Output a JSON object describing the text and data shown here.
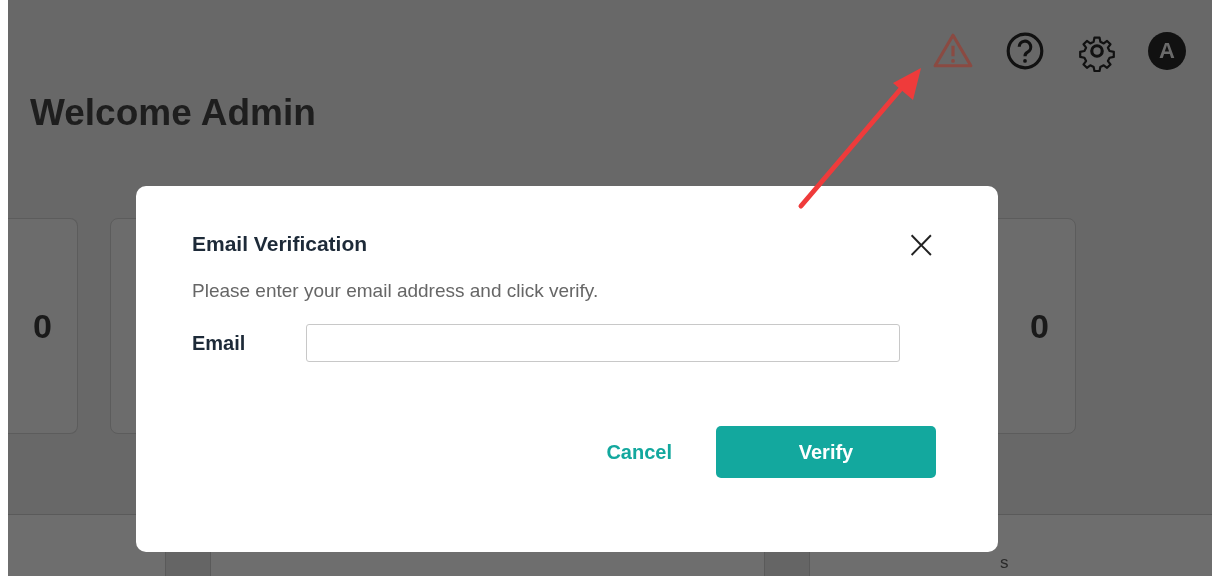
{
  "header": {
    "avatar_letter": "A"
  },
  "page_title": "Welcome Admin",
  "cards": [
    {
      "value": "0"
    },
    {
      "value": "0"
    }
  ],
  "bottom_panel": {
    "text_fragment": "s"
  },
  "dialog": {
    "title": "Email Verification",
    "close": "×",
    "message": "Please enter your email address and click verify.",
    "fields": [
      {
        "label": "Email"
      }
    ],
    "buttons": [
      {
        "label": "Cancel",
        "kind": "text"
      },
      {
        "label": "Verify",
        "kind": "primary"
      }
    ]
  }
}
